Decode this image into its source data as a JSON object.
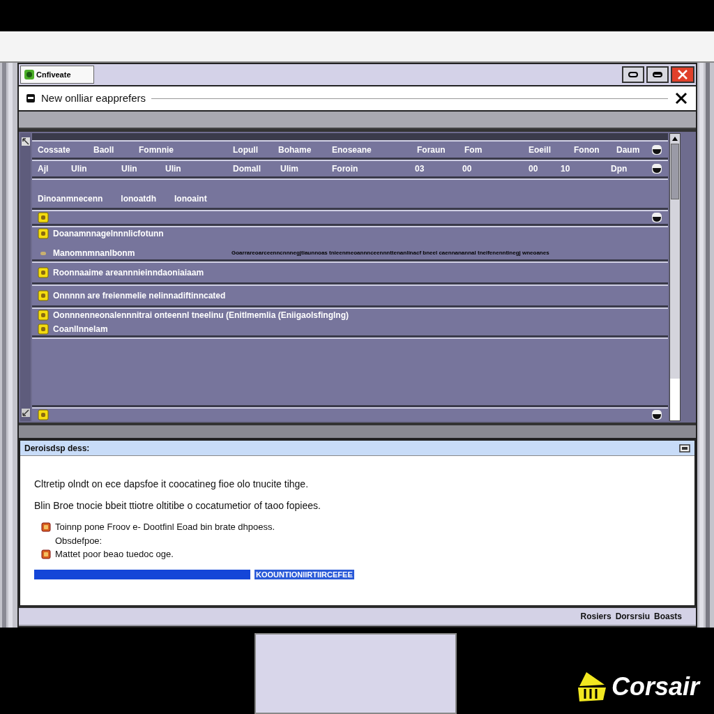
{
  "window": {
    "tab_label": "Cnfiveate",
    "dialog_title": "New onlliar eapprefers"
  },
  "list": {
    "header": [
      "Cossate",
      "Baoll",
      "Fomnnie",
      "Lopull",
      "Bohame",
      "Enoseane",
      "Foraun",
      "Fom",
      "Eoeill",
      "Fonon",
      "Daum"
    ],
    "row": [
      "Ajl",
      "Ulin",
      "Ulin",
      "Ulin",
      "Domall",
      "Ulim",
      "Foroin",
      "03",
      "00",
      "00",
      "10",
      "Dpn"
    ],
    "group": [
      "Dinoanmnecenn",
      "lonoatdh",
      "Ionoaint"
    ],
    "entries": [
      {
        "kind": "marker"
      },
      {
        "kind": "detail",
        "title": "Doanamnnagelnnnlicfotunn",
        "subtitle": "Manomnmnanlbonm",
        "note": "Goarrareoarceenncnnnegjtiaunnoas tnieenmeoannnceennnttenanlinacf bneel caennanannal tneifenenntinegj wneoanes"
      },
      {
        "kind": "items",
        "lines": [
          "Roonnaaime areannnieinndaoniaiaam"
        ]
      },
      {
        "kind": "items",
        "lines": [
          "Onnnnn are freienmelie nelinnadiftinncated"
        ]
      },
      {
        "kind": "items",
        "lines": [
          "Oonnnenneonalennnitrai onteennl tneelinu (Enitlmemlia (Eniigaolsfinglng)",
          "Coanllnnelam"
        ]
      },
      {
        "kind": "empty"
      },
      {
        "kind": "marker"
      }
    ]
  },
  "details": {
    "header": "Deroisdsp dess:",
    "paragraphs": [
      "Cltretip olndt on ece dapsfoe it coocatineg fioe olo tnucite tihge.",
      "Blin Broe tnocie bbeit ttiotre oltitibe o cocatumetior of taoo fopiees."
    ],
    "bullets": [
      {
        "lines": [
          "Toinnp pone Froov e- Dootfinl Eoad bin brate dhpoess.",
          "Obsdefpoe:"
        ]
      },
      {
        "lines": [
          "Mattet poor beao tuedoc oge."
        ]
      }
    ],
    "highlight": "KOOUNTIONIIRTIIRCEFEE"
  },
  "status_bar": [
    "Rosiers",
    "Dorsrsiu",
    "Boasts"
  ],
  "logo": "Corsair"
}
